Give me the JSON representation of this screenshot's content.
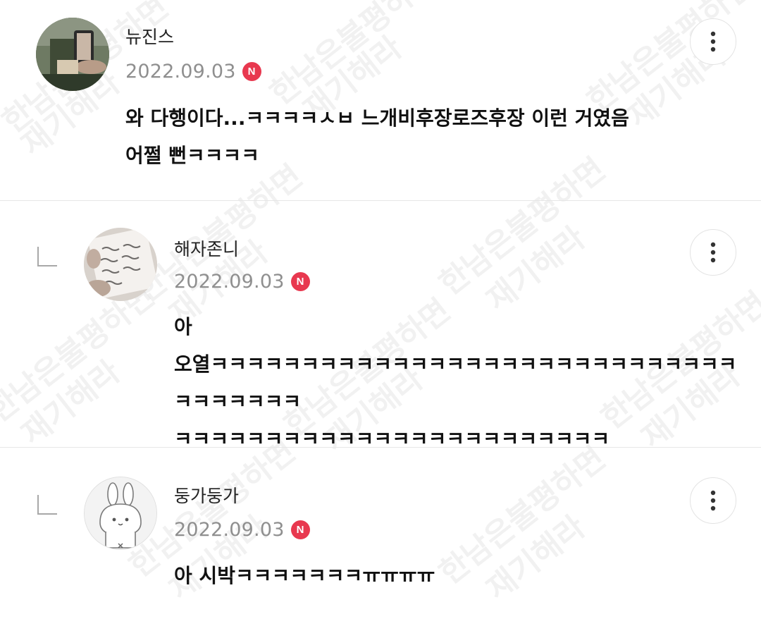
{
  "comments": [
    {
      "author": "뉴진스",
      "date": "2022.09.03",
      "badge": "N",
      "text": "와 다행이다...ㅋㅋㅋㅋㅅㅂ 느개비후장로즈후장 이런 거였음\n어쩔 뻔ㅋㅋㅋㅋ",
      "is_reply": false,
      "avatar_icon": "photo-avatar"
    },
    {
      "author": "해자존니",
      "date": "2022.09.03",
      "badge": "N",
      "text": "아\n오열ㅋㅋㅋㅋㅋㅋㅋㅋㅋㅋㅋㅋㅋㅋㅋㅋㅋㅋㅋㅋㅋㅋㅋㅋㅋㅋㅋㅋㅋㅋㅋㅋㅋㅋㅋㅋ\nㅋㅋㅋㅋㅋㅋㅋㅋㅋㅋㅋㅋㅋㅋㅋㅋㅋㅋㅋㅋㅋㅋㅋㅋ",
      "is_reply": true,
      "avatar_icon": "handwritten-note-avatar"
    },
    {
      "author": "둥가둥가",
      "date": "2022.09.03",
      "badge": "N",
      "text": "아 시박ㅋㅋㅋㅋㅋㅋㅋㅠㅠㅠㅠ",
      "is_reply": true,
      "avatar_icon": "bunny-avatar"
    }
  ],
  "watermark": {
    "line1": "한남은불평하면",
    "line2": "재기해라"
  },
  "icons": {
    "more": "more-vertical-icon",
    "reply": "reply-arrow-icon",
    "new_badge": "new-badge"
  },
  "colors": {
    "badge": "#e8384f",
    "date": "#8f8f8f",
    "divider": "#e6e6e6"
  }
}
